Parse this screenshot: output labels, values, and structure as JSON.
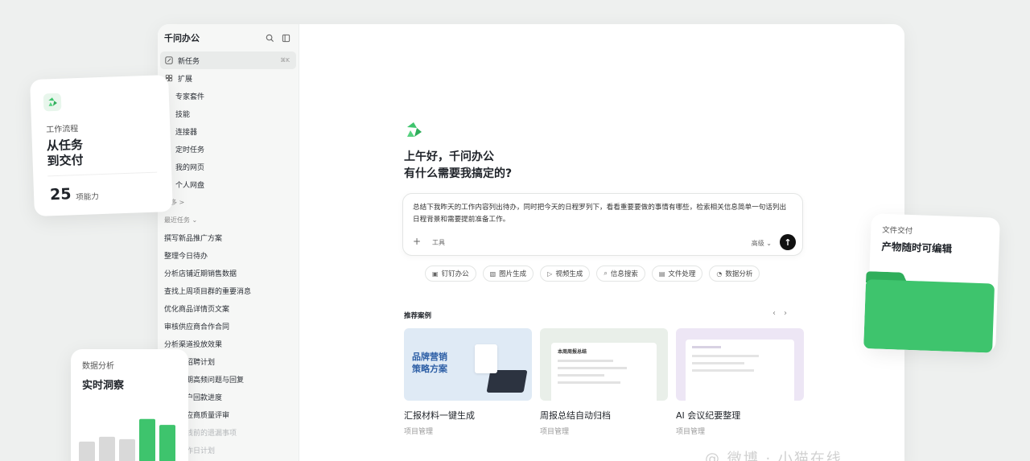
{
  "app": {
    "title": "千问办公",
    "new_task": "新任务",
    "new_task_shortcut": "⌘K"
  },
  "sidebar": {
    "extend_label": "扩展",
    "extend_items": [
      "专家套件",
      "技能",
      "连接器"
    ],
    "collapsible_items": [
      "定时任务",
      "我的网页"
    ],
    "personal_drive": "个人网盘",
    "more_label": "更多 >",
    "recent_label": "最近任务 ⌄",
    "recent_tasks": [
      "撰写新品推广方案",
      "整理今日待办",
      "分析店铺近期销售数据",
      "查找上周项目群的重要消息",
      "优化商品详情页文案",
      "审核供应商合作合同",
      "分析渠道投放效果",
      "下半年招聘计划",
      "整理近期高频问题与回复",
      "跟进客户回款进度",
      "整理供应商质量评审",
      "整理上线前的遗漏事项",
      "整理工作日计划"
    ]
  },
  "main": {
    "greeting_line1": "上午好，千问办公",
    "greeting_line2": "有什么需要我搞定的?",
    "prompt_text": "总结下我昨天的工作内容列出待办，同时把今天的日程罗列下，看看重要要做的事情有哪些，检索相关信息简单一句话列出日程背景和需要提前准备工作。",
    "input_tool": "工具",
    "input_level": "高级 ⌄",
    "send_icon": "arrow-up-icon",
    "chips": [
      {
        "label": "钉钉办公",
        "icon": "▣"
      },
      {
        "label": "图片生成",
        "icon": "▧"
      },
      {
        "label": "视频生成",
        "icon": "▷"
      },
      {
        "label": "信息搜索",
        "icon": "⌕"
      },
      {
        "label": "文件处理",
        "icon": "▤"
      },
      {
        "label": "数据分析",
        "icon": "◔"
      }
    ],
    "recommended_title": "推荐案例",
    "nav_prev": "‹",
    "nav_next": "›",
    "cards": [
      {
        "title": "汇报材料一键生成",
        "tag": "项目管理",
        "thumb_text1": "品牌营销",
        "thumb_text2": "策略方案",
        "bg": "#dfeaf5"
      },
      {
        "title": "周报总结自动归档",
        "tag": "项目管理",
        "thumb_text1": "本周周报总结",
        "thumb_text2": "",
        "bg": "#e9efe9"
      },
      {
        "title": "AI 会议纪要整理",
        "tag": "项目管理",
        "thumb_text1": "",
        "thumb_text2": "",
        "bg": "#ede6f5"
      }
    ]
  },
  "floating": {
    "workflow": {
      "label": "工作流程",
      "headline_line1": "从任务",
      "headline_line2": "到交付",
      "count": "25",
      "unit": "项能力"
    },
    "analytics": {
      "label": "数据分析",
      "headline": "实时洞察",
      "bars": [
        0.34,
        0.42,
        0.38,
        0.72,
        0.62
      ]
    },
    "delivery": {
      "label": "文件交付",
      "headline": "产物随时可编辑"
    }
  },
  "colors": {
    "brand_green": "#3ec46d",
    "bar_grey": "#d9d9d9",
    "send_black": "#111111"
  },
  "watermark": "@ 微博 · 小猫在线"
}
